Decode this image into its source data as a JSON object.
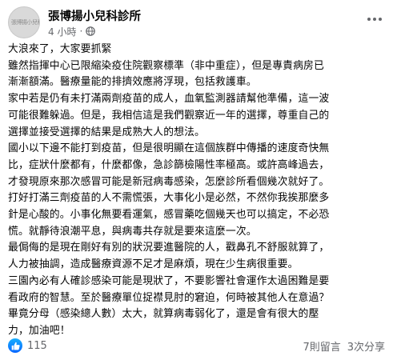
{
  "post": {
    "page_name": "張博揚小兒科診所",
    "timestamp": "4 小時",
    "separator": "·",
    "privacy_icon": "globe-icon",
    "more_icon": "more-dots-icon",
    "avatar_text": "張博揚小兒科診所",
    "lines": [
      "大浪來了，大家要抓緊",
      "雖然指揮中心已限縮染疫住院觀察標準（非中重症），但是專責病房已",
      "漸漸額滿。醫療量能的排擠效應將浮現，包括救護車。",
      "家中若是仍有未打滿兩劑疫苗的成人，血氧監測器請幫他準備，這一波",
      "可能很難躲過。但是，我相信這是我們觀察近一年的選擇，尊重自己的",
      "選擇並接受選擇的結果是成熟大人的想法。",
      "國小以下邊不能打到疫苗，但是很明顯在這個族群中傳播的速度奇快無",
      "比，症狀什麼都有，什麼都像，急診篩檢陽性率極高。或許高峰過去，",
      "才發現原來那次感冒可能是新冠病毒感染，怎麼診所看個幾次就好了。",
      "打好打滿三劑疫苗的人不需慌張，大事化小是必然，不然你我挨那麼多",
      "針是心酸的。小事化無要看運氣，感冒藥吃個幾天也可以搞定，不必恐",
      "慌。就靜待浪潮平息，與病毒共存就是要來這麼一次。",
      "最侷侮的是現在剛好有別的狀況要進醫院的人，戳鼻孔不舒服就算了，",
      "人力被抽調，造成醫療資源不足才是麻煩，現在少生病很重要。",
      "三園內必有人確診感染可能是現狀了，不要影響社會運作太過困難是要",
      "看政府的智慧。至於醫療單位捉襟見肘的窘迫，何時被其他人在意過？",
      "畢竟分母（感染總人數）太大，就算病毒弱化了，還是會有很大的壓",
      "力，加油吧！"
    ]
  },
  "footer": {
    "like_icon": "thumbs-up-icon",
    "reaction_count": "115",
    "comments_label": "7則留言",
    "shares_label": "3次分享"
  },
  "colors": {
    "text": "#050505",
    "secondary": "#65676b",
    "like_blue": "#0866ff"
  }
}
